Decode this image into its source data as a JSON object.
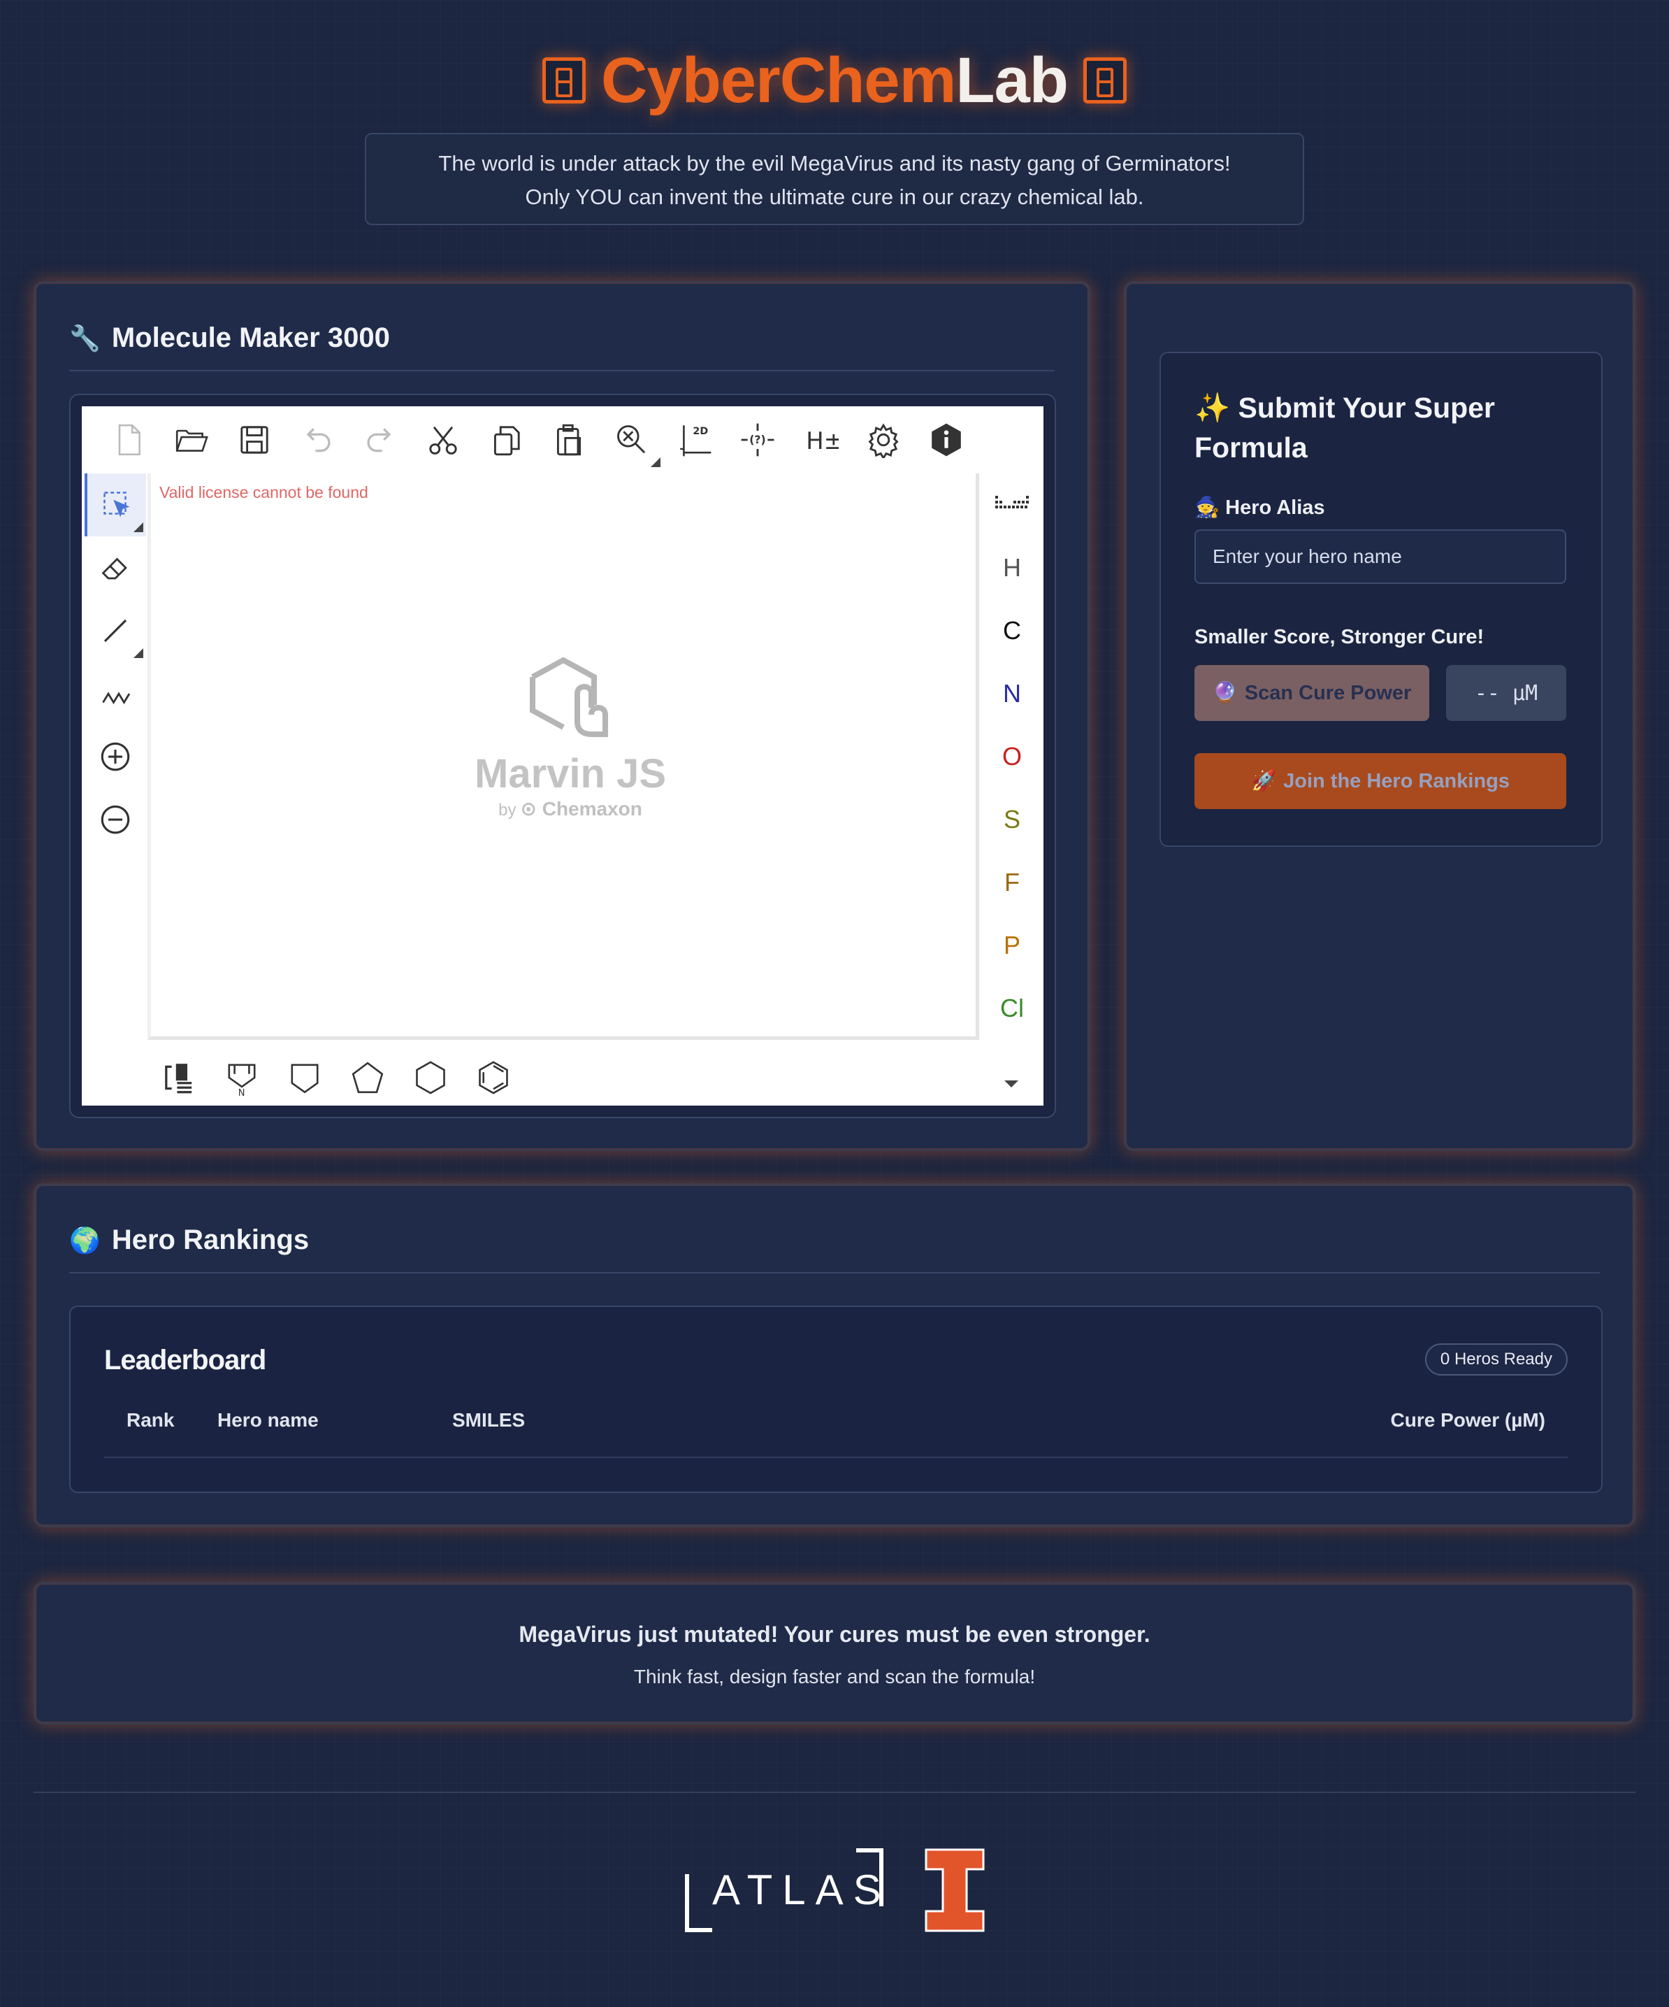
{
  "header": {
    "title_part1": "CyberChem",
    "title_part2": "Lab",
    "intro_line1": "The world is under attack by the evil MegaVirus and its nasty gang of Germinators!",
    "intro_line2": "Only YOU can invent the ultimate cure in our crazy chemical lab."
  },
  "maker": {
    "icon": "🔧",
    "title": "Molecule Maker 3000",
    "license_msg": "Valid license cannot be found",
    "marvin_name": "Marvin JS",
    "marvin_by": "by",
    "marvin_vendor": "Chemaxon",
    "toolbar_top": [
      "new-document-icon",
      "open-folder-icon",
      "save-icon",
      "undo-icon",
      "redo-icon",
      "cut-icon",
      "copy-icon",
      "paste-icon",
      "zoom-icon",
      "clean-2d-icon",
      "query-atom-icon",
      "hydrogen-toggle-icon",
      "settings-icon",
      "info-icon"
    ],
    "toolbar_left": [
      "select-icon",
      "eraser-icon",
      "bond-icon",
      "chain-icon",
      "charge-plus-icon",
      "charge-minus-icon"
    ],
    "elements": [
      {
        "symbol": "H",
        "color": "#555555"
      },
      {
        "symbol": "C",
        "color": "#111111"
      },
      {
        "symbol": "N",
        "color": "#2b2ba8"
      },
      {
        "symbol": "O",
        "color": "#cc1f1f"
      },
      {
        "symbol": "S",
        "color": "#7a7a16"
      },
      {
        "symbol": "F",
        "color": "#9a6a10"
      },
      {
        "symbol": "P",
        "color": "#b8720b"
      },
      {
        "symbol": "Cl",
        "color": "#3a8a2a"
      }
    ],
    "toolbar_bottom": [
      "bracket-icon",
      "template-n-icon",
      "ring-4-icon",
      "ring-5-icon",
      "ring-6-icon",
      "benzene-icon"
    ]
  },
  "submit": {
    "icon": "✨",
    "title": "Submit Your Super Formula",
    "alias_icon": "🧙",
    "alias_label": "Hero Alias",
    "alias_placeholder": "Enter your hero name",
    "score_hint": "Smaller Score, Stronger Cure!",
    "scan_icon": "🔮",
    "scan_label": "Scan Cure Power",
    "score_value": "-- µM",
    "join_icon": "🚀",
    "join_label": "Join the Hero Rankings"
  },
  "rankings": {
    "icon": "🌍",
    "title": "Hero Rankings",
    "board_title": "Leaderboard",
    "badge": "0 Heros Ready",
    "columns": [
      "Rank",
      "Hero name",
      "SMILES",
      "Cure Power (µM)"
    ]
  },
  "mutation": {
    "title": "MegaVirus just mutated! Your cures must be even stronger.",
    "subtitle": "Think fast, design faster and scan the formula!"
  },
  "footer": {
    "logo1": "ATLAS",
    "logo2": "I"
  },
  "colors": {
    "accent": "#e9621e",
    "background": "#1c2640",
    "card": "#1f2b48"
  }
}
